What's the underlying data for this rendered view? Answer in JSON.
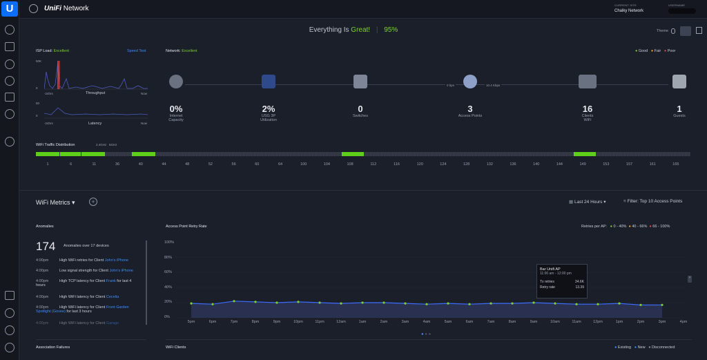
{
  "app": {
    "brand_italic": "UniFi",
    "brand": "Network",
    "logo_letter": "U"
  },
  "top": {
    "site_label": "CURRENT SITE",
    "site_value": "Chalky Network",
    "user_label": "USERNAME",
    "user_value": ""
  },
  "status": {
    "prefix": "Everything Is",
    "great": "Great!",
    "score": "95%",
    "theme_label": "Theme"
  },
  "isp": {
    "label": "ISP Load:",
    "state": "Excellent",
    "speed_test": "Speed Test",
    "y_top": "50K",
    "y_zero": "0",
    "throughput": "Throughput",
    "time_left": "-24hrs",
    "time_right": "Now",
    "lat_top": "50",
    "lat_zero": "0",
    "latency": "Latency"
  },
  "network": {
    "label": "Network:",
    "state": "Excellent",
    "legend": [
      "Good",
      "Fair",
      "Poor"
    ],
    "legend_colors": [
      "#7bd32b",
      "#f0a030",
      "#e04848"
    ],
    "rate_left": "0 bps",
    "rate_right": "10.4 Kbps"
  },
  "devices": [
    {
      "value": "0%",
      "label": "Internet",
      "sub": "Capacity"
    },
    {
      "value": "2%",
      "label": "USG 3P",
      "sub": "Utilization"
    },
    {
      "value": "0",
      "label": "Switches",
      "sub": ""
    },
    {
      "value": "3",
      "label": "Access Points",
      "sub": ""
    },
    {
      "value": "16",
      "label": "Clients",
      "sub": "WiFi"
    },
    {
      "value": "1",
      "label": "Guests",
      "sub": ""
    }
  ],
  "wifi_dist": {
    "label": "WiFi Traffic Distribution",
    "band1": "2.4GHz",
    "band2": "5GHz",
    "channels": [
      "1",
      "6",
      "11",
      "36",
      "40",
      "44",
      "48",
      "52",
      "56",
      "60",
      "64",
      "100",
      "104",
      "108",
      "112",
      "116",
      "120",
      "124",
      "128",
      "132",
      "136",
      "140",
      "144",
      "149",
      "153",
      "157",
      "161",
      "165"
    ]
  },
  "metrics": {
    "title": "WiFi Metrics",
    "range": "Last 24 Hours",
    "filter": "Filter: Top 10 Access Points"
  },
  "anomalies": {
    "title": "Anomalies",
    "count": "174",
    "summary": "Anomalies over 17 devices",
    "rows": [
      {
        "time": "4:00pm",
        "text": "High WiFi retries for Client",
        "client": "John's iPhone",
        "extra": ""
      },
      {
        "time": "4:00pm",
        "text": "Low signal strength for Client",
        "client": "John's iPhone",
        "extra": ""
      },
      {
        "time": "4:00pm",
        "text": "High TCP latency for Client",
        "client": "Frank",
        "extra": "for last 4 hours"
      },
      {
        "time": "4:00pm",
        "text": "High WiFi latency for Client",
        "client": "Cecelia",
        "extra": ""
      },
      {
        "time": "4:00pm",
        "text": "High WiFi latency for Client",
        "client": "Front Garden Spotlight (Govee)",
        "extra": "for last 3 hours"
      },
      {
        "time": "4:00pm",
        "text": "High WiFi latency for Client",
        "client": "Garage",
        "extra": ""
      }
    ]
  },
  "retry": {
    "title": "Access Point Retry Rate",
    "legend_label": "Retries per AP:",
    "legend": [
      "0 - 40%",
      "40 - 66%",
      "66 - 100%"
    ],
    "legend_colors": [
      "#7bd32b",
      "#f0a030",
      "#e04848"
    ],
    "y_ticks": [
      "100%",
      "80%",
      "60%",
      "40%",
      "20%",
      "0%"
    ],
    "x_ticks": [
      "5pm",
      "6pm",
      "7pm",
      "8pm",
      "9pm",
      "10pm",
      "11pm",
      "12am",
      "1am",
      "2am",
      "3am",
      "4am",
      "5am",
      "6am",
      "7am",
      "8am",
      "9am",
      "10am",
      "11am",
      "12pm",
      "1pm",
      "2pm",
      "3pm",
      "4pm"
    ],
    "tooltip": {
      "title": "Bar Unifi AP",
      "time": "11:00 am - 12:00 pm",
      "r1_label": "Tx retries",
      "r1_val": "34.6K",
      "r2_label": "Retry rate",
      "r2_val": "13.39"
    }
  },
  "footer": {
    "assoc": "Association Failures",
    "clients": "WiFi Clients",
    "legend": [
      "Existing",
      "New",
      "Disconnected"
    ]
  },
  "chart_data": {
    "type": "line",
    "title": "Access Point Retry Rate",
    "x": [
      "5pm",
      "6pm",
      "7pm",
      "8pm",
      "9pm",
      "10pm",
      "11pm",
      "12am",
      "1am",
      "2am",
      "3am",
      "4am",
      "5am",
      "6am",
      "7am",
      "8am",
      "9am",
      "10am",
      "11am",
      "12pm",
      "1pm",
      "2pm",
      "3pm"
    ],
    "series": [
      {
        "values": [
          19,
          18,
          22,
          21,
          20,
          21,
          20,
          19,
          20,
          20,
          19,
          18,
          19,
          18,
          19,
          19,
          20,
          19,
          18,
          18,
          19,
          17,
          17
        ]
      }
    ],
    "ylim": [
      0,
      100
    ],
    "grid": true
  }
}
